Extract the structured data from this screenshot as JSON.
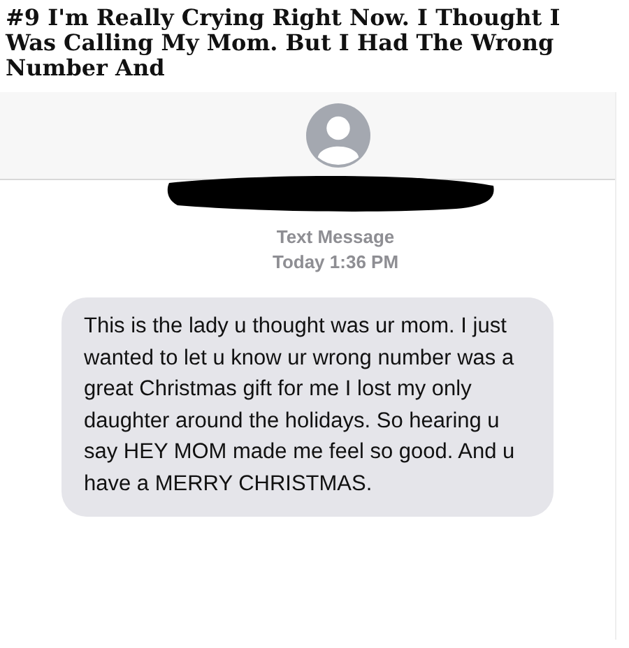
{
  "article": {
    "title": "#9 I'm Really Crying Right Now. I Thought I Was Calling My Mom. But I Had The Wrong Number And"
  },
  "conversation": {
    "label": "Text Message",
    "time": "Today 1:36 PM",
    "messages": [
      {
        "kind": "received",
        "text": "This is the lady u thought was ur mom. I just wanted to let u know ur wrong number was a great Christmas gift for me I lost my only daughter around the holidays. So hearing u say HEY MOM made me feel so good. And u have a MERRY CHRISTMAS."
      }
    ]
  }
}
